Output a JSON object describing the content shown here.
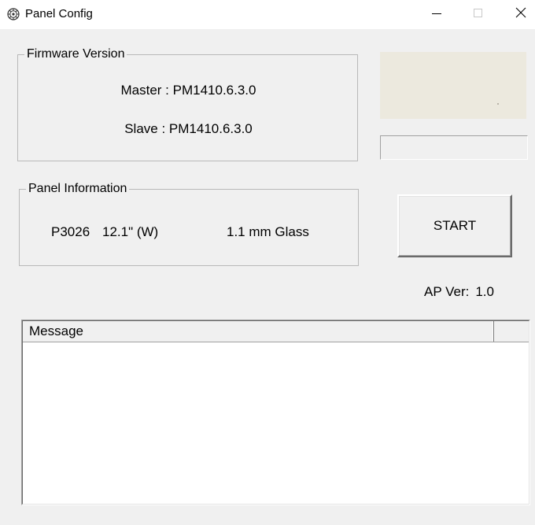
{
  "window": {
    "title": "Panel Config",
    "icon": "gear-icon",
    "controls": {
      "minimize": "minimize-icon",
      "maximize": "maximize-icon",
      "close": "close-icon"
    }
  },
  "firmware": {
    "legend": "Firmware Version",
    "master": "Master : PM1410.6.3.0",
    "slave": "Slave : PM1410.6.3.0"
  },
  "panel_info": {
    "legend": "Panel Information",
    "model": "P3026",
    "size": "12.1\" (W)",
    "glass": "1.1 mm Glass"
  },
  "controls": {
    "start_label": "START",
    "ap_ver_label": "AP Ver:",
    "ap_ver_value": "1.0"
  },
  "message_list": {
    "columns": [
      "Message",
      ""
    ],
    "rows": []
  },
  "colors": {
    "window_bg": "#f0f0f0",
    "titlebar_bg": "#ffffff",
    "status_panel_bg": "#ece9de"
  }
}
